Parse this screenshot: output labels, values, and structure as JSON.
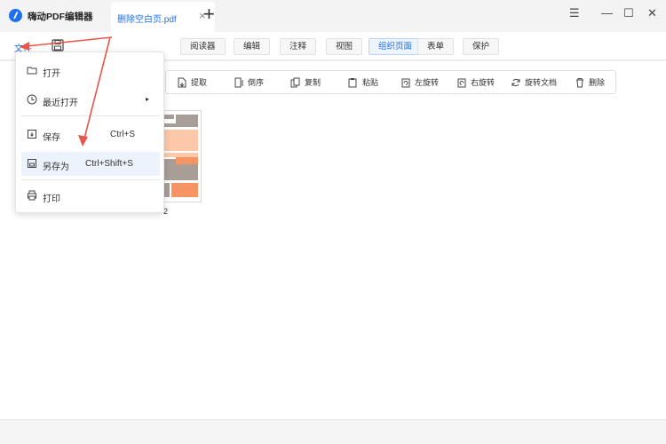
{
  "app": {
    "title": "嗨动PDF编辑器"
  },
  "tabs": [
    {
      "label": "删除空白页.pdf"
    }
  ],
  "window": {
    "menu_glyph": "☰",
    "minimize_glyph": "—",
    "maximize_glyph": "☐",
    "close_glyph": "✕"
  },
  "menubar": {
    "file": "文件",
    "tabs": [
      "阅读器",
      "编辑",
      "注释",
      "视图",
      "组织页面",
      "表单",
      "保护"
    ],
    "active_tab": "组织页面"
  },
  "toolbar": {
    "items": [
      "提取",
      "倒序",
      "复制",
      "粘贴",
      "左旋转",
      "右旋转",
      "旋转文档",
      "删除"
    ]
  },
  "file_menu": {
    "items": [
      {
        "label": "打开",
        "shortcut": "",
        "icon": "folder-open-icon"
      },
      {
        "label": "最近打开",
        "shortcut": "",
        "icon": "clock-icon",
        "submenu": true
      },
      {
        "label": "保存",
        "shortcut": "Ctrl+S",
        "icon": "save-icon"
      },
      {
        "label": "另存为",
        "shortcut": "Ctrl+Shift+S",
        "icon": "save-as-icon",
        "highlighted": true
      },
      {
        "label": "打印",
        "shortcut": "",
        "icon": "printer-icon"
      }
    ]
  },
  "pages": [
    {
      "number": "2"
    }
  ],
  "colors": {
    "accent": "#1e6ff0",
    "annotation_arrow": "#e8554a",
    "thumb_gray": "#a89d97",
    "thumb_peach": "#fcc8a9",
    "thumb_orange": "#f79463"
  }
}
